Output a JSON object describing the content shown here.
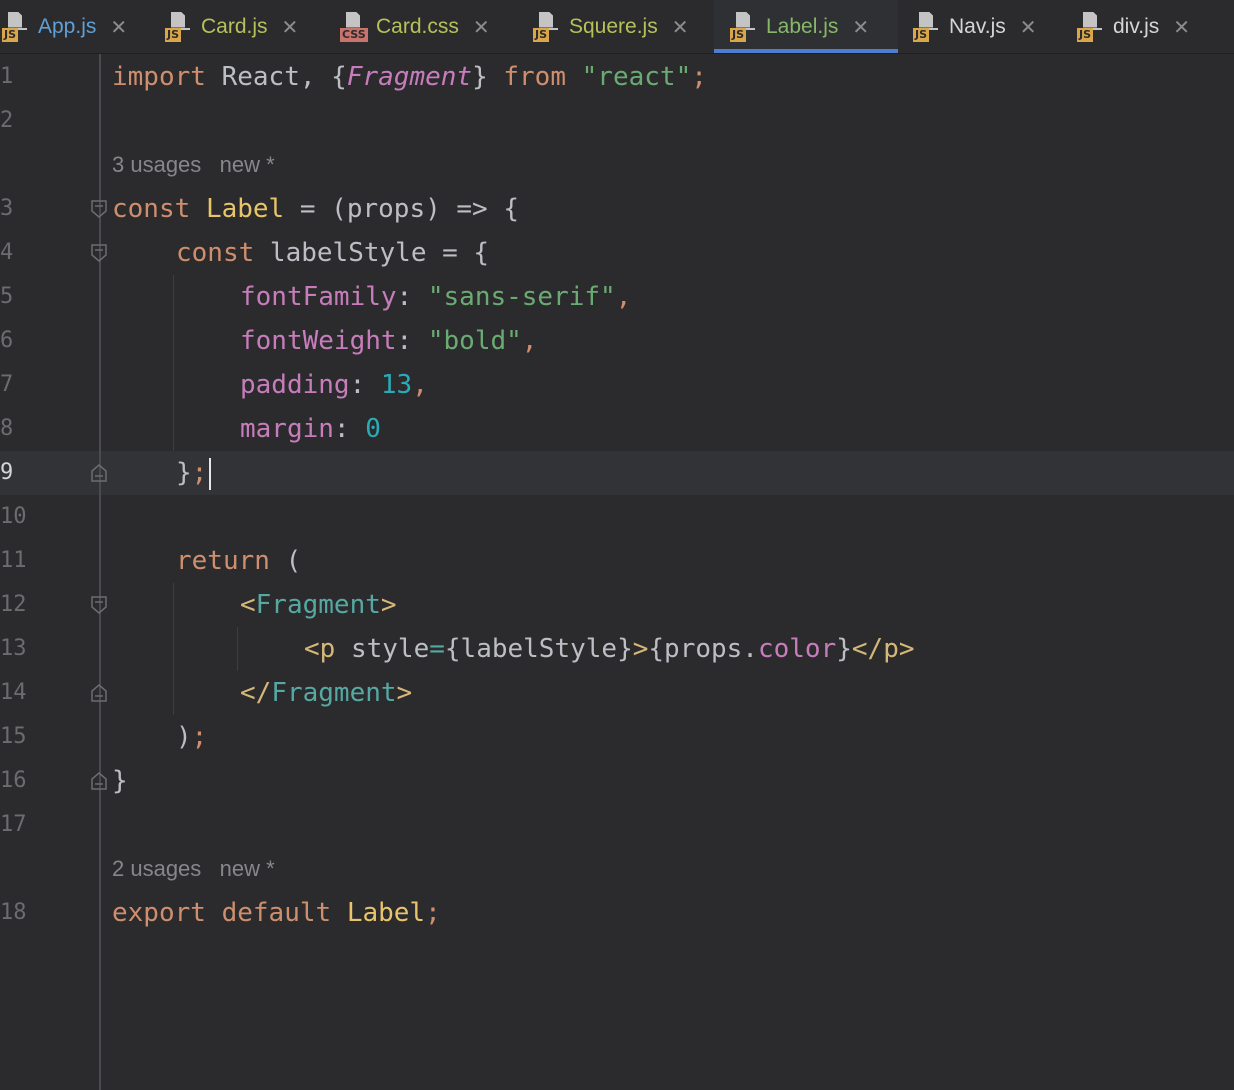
{
  "tabs": [
    {
      "label": "App.js",
      "type": "JS",
      "color": "#5fa0d6",
      "active": false
    },
    {
      "label": "Card.js",
      "type": "JS",
      "color": "#b7c15a",
      "active": false
    },
    {
      "label": "Card.css",
      "type": "CSS",
      "color": "#b7c15a",
      "active": false
    },
    {
      "label": "Squere.js",
      "type": "JS",
      "color": "#b7c15a",
      "active": false
    },
    {
      "label": "Label.js",
      "type": "JS",
      "color": "#87b86a",
      "active": true
    },
    {
      "label": "Nav.js",
      "type": "JS",
      "color": "#d5d5d5",
      "active": false
    },
    {
      "label": "div.js",
      "type": "JS",
      "color": "#d5d5d5",
      "active": false
    }
  ],
  "close_glyph": "✕",
  "hints": {
    "label_usages": "3 usages",
    "label_new": "new *",
    "export_usages": "2 usages",
    "export_new": "new *"
  },
  "lines": [
    {
      "n": "1"
    },
    {
      "n": "2"
    },
    {
      "n": "3"
    },
    {
      "n": "4"
    },
    {
      "n": "5"
    },
    {
      "n": "6"
    },
    {
      "n": "7"
    },
    {
      "n": "8"
    },
    {
      "n": "9"
    },
    {
      "n": "10"
    },
    {
      "n": "11"
    },
    {
      "n": "12"
    },
    {
      "n": "13"
    },
    {
      "n": "14"
    },
    {
      "n": "15"
    },
    {
      "n": "16"
    },
    {
      "n": "17"
    },
    {
      "n": "18"
    }
  ],
  "code": {
    "l1": {
      "import": "import",
      "react": "React",
      "comma": ", {",
      "frag": "Fragment",
      "close": "}",
      "from": "from",
      "mod": "\"react\"",
      "semi": ";"
    },
    "l3": {
      "const": "const",
      "name": "Label",
      "rest": " = (props) => {"
    },
    "l4": {
      "const": "const",
      "rest": " labelStyle = {"
    },
    "l5": {
      "key": "fontFamily",
      "colon": ": ",
      "val": "\"sans-serif\"",
      "comma": ","
    },
    "l6": {
      "key": "fontWeight",
      "colon": ": ",
      "val": "\"bold\"",
      "comma": ","
    },
    "l7": {
      "key": "padding",
      "colon": ": ",
      "val": "13",
      "comma": ","
    },
    "l8": {
      "key": "margin",
      "colon": ": ",
      "val": "0"
    },
    "l9": {
      "brace": "}",
      "semi": ";"
    },
    "l11": {
      "ret": "return",
      "rest": " ("
    },
    "l12": {
      "open": "<",
      "tag": "Fragment",
      "close": ">"
    },
    "l13": {
      "open": "<p",
      "attr": " style",
      "eq": "=",
      "expr1": "{labelStyle}",
      "gt": ">",
      "expr2a": "{props.",
      "prop": "color",
      "expr2b": "}",
      "endtag": "</p>"
    },
    "l14": {
      "open": "</",
      "tag": "Fragment",
      "close": ">"
    },
    "l15": {
      "paren": ")",
      "semi": ";"
    },
    "l16": {
      "brace": "}"
    },
    "l18": {
      "export": "export",
      "def": "default",
      "name": "Label",
      "semi": ";"
    }
  }
}
